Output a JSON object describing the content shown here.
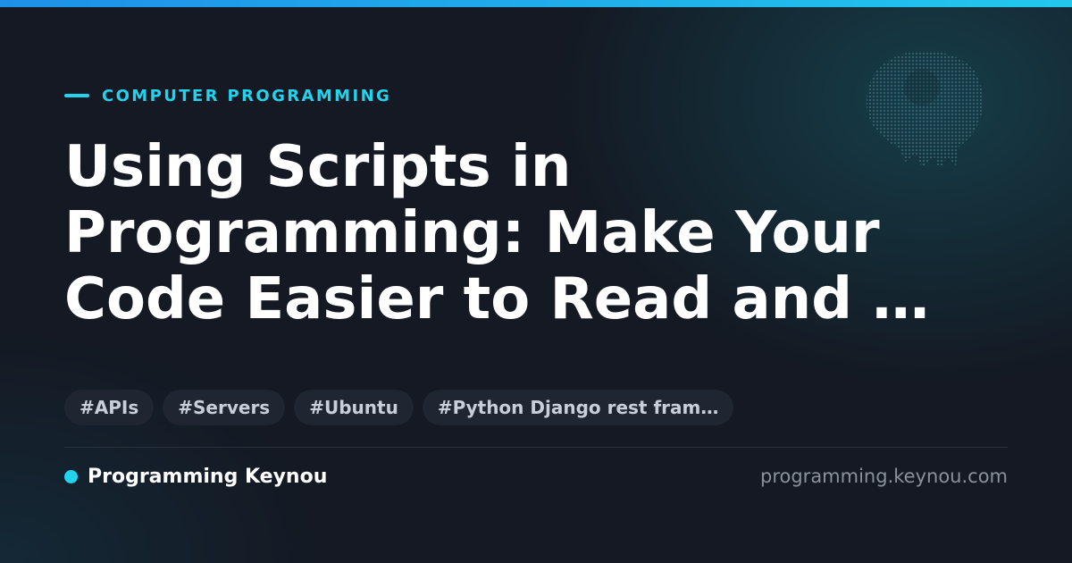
{
  "category": "COMPUTER PROGRAMMING",
  "title_lines": [
    "Using Scripts in",
    "Programming: Make Your",
    "Code Easier to Read and …"
  ],
  "tags": [
    "#APIs",
    "#Servers",
    "#Ubuntu",
    "#Python Django rest fram…"
  ],
  "brand": "Programming Keynou",
  "site_url": "programming.keynou.com",
  "colors": {
    "background": "#141923",
    "accent": "#22d3ee",
    "top_bar_start": "#1e90e8",
    "top_bar_end": "#22c8ec",
    "title": "#ffffff",
    "tag_background": "#1f2531",
    "tag_text": "#c9ced8",
    "muted_text": "#8b919c"
  },
  "icons": {
    "decoration": "dotted-brain-icon"
  }
}
